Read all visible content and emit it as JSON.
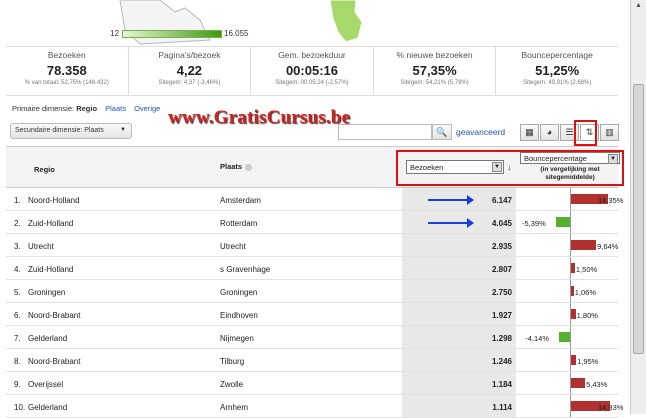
{
  "map": {
    "legend_min": "12",
    "legend_max": "16.055"
  },
  "metrics": [
    {
      "label": "Bezoeken",
      "value": "78.358",
      "sub": "% van totaal: 52,75% (148.432)"
    },
    {
      "label": "Pagina's/bezoek",
      "value": "4,22",
      "sub": "Sitegem: 4,37 (-3,46%)"
    },
    {
      "label": "Gem. bezoekduur",
      "value": "00:05:16",
      "sub": "Sitegem: 00:05:24 (-2,57%)"
    },
    {
      "label": "% nieuwe bezoeken",
      "value": "57,35%",
      "sub": "Sitegem: 54,21% (5,79%)"
    },
    {
      "label": "Bouncepercentage",
      "value": "51,25%",
      "sub": "Sitegem: 49,91% (2,68%)"
    }
  ],
  "dimension": {
    "label": "Primaire dimensie:",
    "selected": "Regio",
    "link1": "Plaats",
    "link2": "Overige"
  },
  "watermark": "www.GratisCursus.be",
  "secondary_dimension": "Secundaire dimensie: Plaats",
  "search": {
    "advanced": "geavanceerd"
  },
  "table": {
    "col_regio": "Regio",
    "col_plaats": "Plaats",
    "metric_select": "Bezoeken",
    "compare_select": "Bouncepercentage",
    "compare_note": "(in vergelijking met sitegemiddelde)",
    "rows": [
      {
        "n": "1.",
        "regio": "Noord-Holland",
        "plaats": "Amsterdam",
        "bezoeken": "6.147",
        "pct": "14,35%",
        "delta": 14.35
      },
      {
        "n": "2.",
        "regio": "Zuid-Holland",
        "plaats": "Rotterdam",
        "bezoeken": "4.045",
        "pct": "-5,39%",
        "delta": -5.39
      },
      {
        "n": "3.",
        "regio": "Utrecht",
        "plaats": "Utrecht",
        "bezoeken": "2.935",
        "pct": "9,64%",
        "delta": 9.64
      },
      {
        "n": "4.",
        "regio": "Zuid-Holland",
        "plaats": "s Gravenhage",
        "bezoeken": "2.807",
        "pct": "1,50%",
        "delta": 1.5
      },
      {
        "n": "5.",
        "regio": "Groningen",
        "plaats": "Groningen",
        "bezoeken": "2.750",
        "pct": "1,06%",
        "delta": 1.06
      },
      {
        "n": "6.",
        "regio": "Noord-Brabant",
        "plaats": "Eindhoven",
        "bezoeken": "1.927",
        "pct": "1,80%",
        "delta": 1.8
      },
      {
        "n": "7.",
        "regio": "Gelderland",
        "plaats": "Nijmegen",
        "bezoeken": "1.298",
        "pct": "-4,14%",
        "delta": -4.14
      },
      {
        "n": "8.",
        "regio": "Noord-Brabant",
        "plaats": "Tilburg",
        "bezoeken": "1.246",
        "pct": "1,95%",
        "delta": 1.95
      },
      {
        "n": "9.",
        "regio": "Overijssel",
        "plaats": "Zwolle",
        "bezoeken": "1.184",
        "pct": "5,43%",
        "delta": 5.43
      },
      {
        "n": "10.",
        "regio": "Gelderland",
        "plaats": "Arnhem",
        "bezoeken": "1.114",
        "pct": "14,93%",
        "delta": 14.93
      }
    ]
  },
  "colors": {
    "bar_positive": "#b13030",
    "bar_negative": "#56b030",
    "highlight": "#e01010",
    "arrow": "#1a3fe0"
  },
  "icons": [
    "search-icon",
    "table-view-icon",
    "pie-view-icon",
    "performance-view-icon",
    "comparison-view-icon",
    "pivot-view-icon"
  ]
}
